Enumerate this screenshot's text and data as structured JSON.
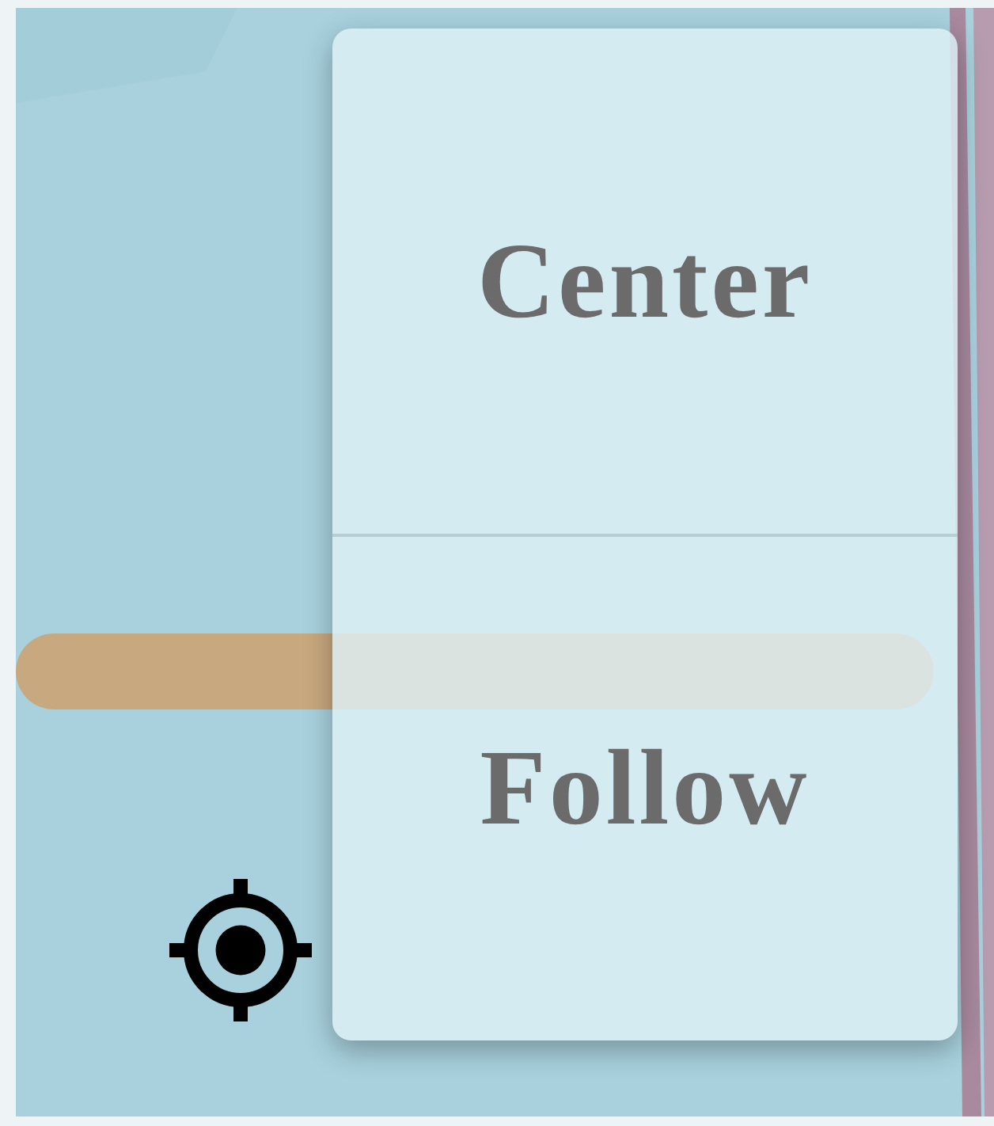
{
  "menu": {
    "items": [
      {
        "label": "Center"
      },
      {
        "label": "Follow"
      }
    ]
  }
}
